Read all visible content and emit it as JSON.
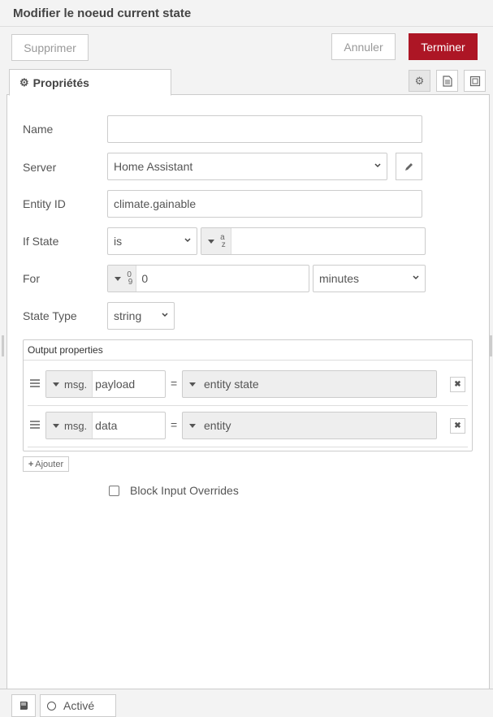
{
  "dialog": {
    "title": "Modifier le noeud current state",
    "delete_label": "Supprimer",
    "cancel_label": "Annuler",
    "done_label": "Terminer"
  },
  "tabs": {
    "properties_label": "Propriétés"
  },
  "form": {
    "name": {
      "label": "Name",
      "value": ""
    },
    "server": {
      "label": "Server",
      "value": "Home Assistant"
    },
    "entity_id": {
      "label": "Entity ID",
      "value": "climate.gainable"
    },
    "if_state": {
      "label": "If State",
      "operator": "is",
      "value": ""
    },
    "for": {
      "label": "For",
      "value": "0",
      "unit": "minutes"
    },
    "state_type": {
      "label": "State Type",
      "value": "string"
    }
  },
  "output": {
    "title": "Output properties",
    "rows": [
      {
        "prefix": "msg.",
        "property": "payload",
        "eq": "=",
        "value": "entity state"
      },
      {
        "prefix": "msg.",
        "property": "data",
        "eq": "=",
        "value": "entity"
      }
    ],
    "add_label": "Ajouter"
  },
  "block_input_overrides": {
    "label": "Block Input Overrides",
    "checked": false
  },
  "footer": {
    "status_label": "Activé"
  },
  "colors": {
    "primary": "#ad1625"
  }
}
